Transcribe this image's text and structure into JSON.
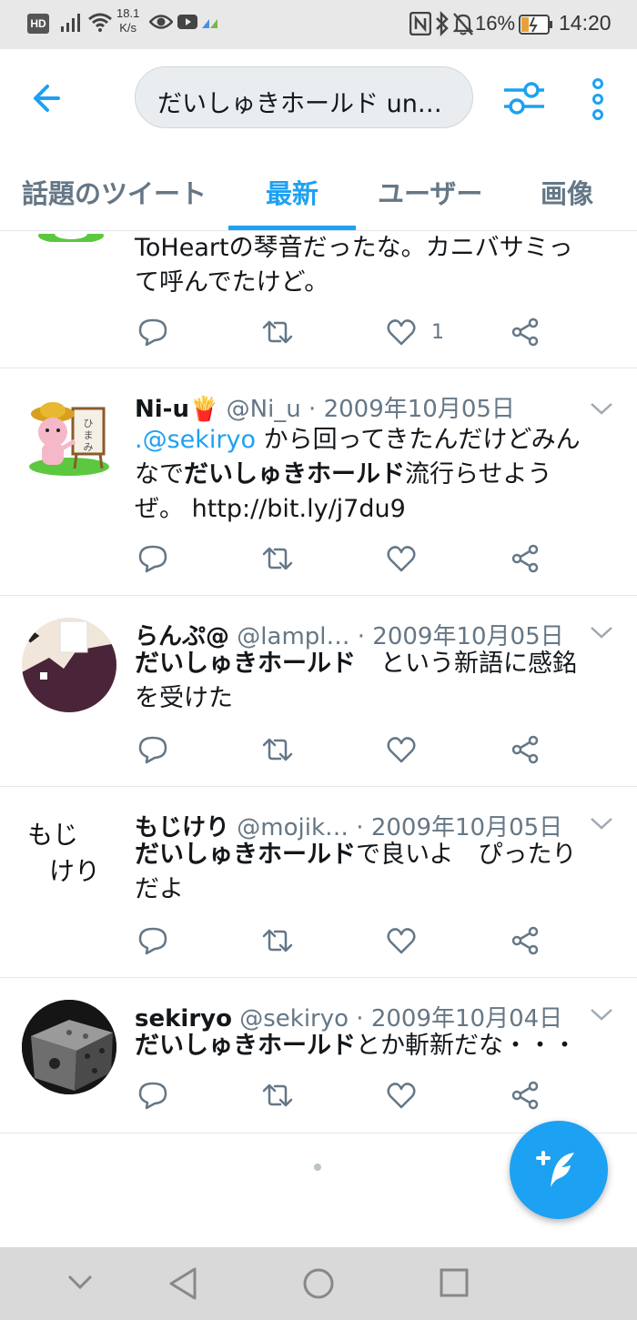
{
  "status_bar": {
    "hd": "HD",
    "net_speed_value": "18.1",
    "net_speed_unit": "K/s",
    "battery_percent": "16%",
    "time": "14:20",
    "icons": [
      "signal-icon",
      "wifi-icon",
      "eye-icon",
      "youtube-icon",
      "nfc-icon",
      "bluetooth-icon",
      "mute-icon",
      "battery-icon"
    ]
  },
  "app_bar": {
    "search_query": "だいしゅきホールド un…",
    "icons": [
      "back-arrow-icon",
      "filter-icon",
      "more-vertical-icon"
    ],
    "accent": "#1da1f2"
  },
  "tabs": [
    {
      "label": "話題のツイート",
      "active": false
    },
    {
      "label": "最新",
      "active": true
    },
    {
      "label": "ユーザー",
      "active": false
    },
    {
      "label": "画像",
      "active": false
    }
  ],
  "tweets": [
    {
      "body_line1": "ToHeartの琴音だったな。カニバサミっ",
      "body_line2": "て呼んでたけど。",
      "like_count": "1"
    },
    {
      "name": "Ni-u🍟",
      "handle": "@Ni_u",
      "date": "· 2009年10月05日",
      "body_mention": ".@sekiryo",
      "body_part1": " から回ってきたんだけどみん",
      "body_part2": "なで",
      "body_bold": "だいしゅきホールド",
      "body_part3": "流行らせよう",
      "body_part4": "ぜ。 http://bit.ly/j7du9"
    },
    {
      "name": "らんぷ@",
      "handle": "@lampl…",
      "date": "· 2009年10月05日",
      "body_bold": "だいしゅきホールド",
      "body_part1": "　という新語に感銘",
      "body_part2": "を受けた"
    },
    {
      "name": "もじけり",
      "handle": "@mojik…",
      "date": "· 2009年10月05日",
      "body_bold": "だいしゅきホールド",
      "body_part1": "で良いよ　ぴったり",
      "body_part2": "だよ",
      "avatar_text": "もじ けり"
    },
    {
      "name": "sekiryo",
      "handle": "@sekiryo",
      "date": "· 2009年10月04日",
      "body_bold": "だいしゅきホールド",
      "body_part1": "とか斬新だな・・・"
    }
  ],
  "action_icons": [
    "reply-icon",
    "retweet-icon",
    "like-icon",
    "share-icon"
  ],
  "fab": {
    "icon": "compose-tweet-icon"
  },
  "nav_bar": {
    "icons": [
      "nav-down-icon",
      "nav-back-icon",
      "nav-home-icon",
      "nav-recents-icon"
    ]
  }
}
